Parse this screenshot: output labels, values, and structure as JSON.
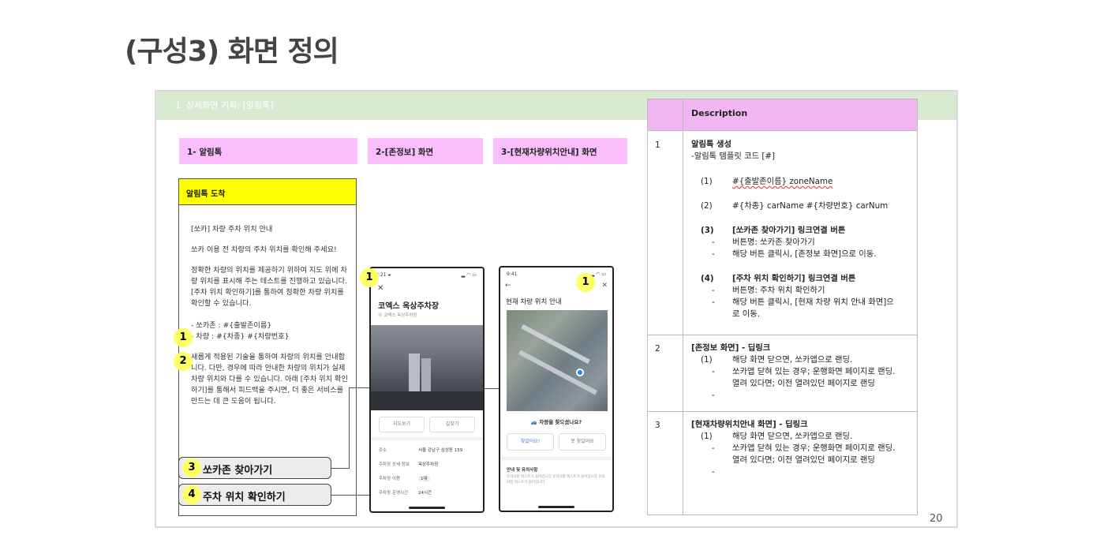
{
  "page_title": "(구성3) 화면 정의",
  "slide_header": "1.      상세화면 기획: [알림톡]",
  "page_number": "20",
  "columns": {
    "col1": "1- 알림톡",
    "col2": "2-[존정보] 화면",
    "col3": "3-[현재차량위치안내] 화면"
  },
  "kakao": {
    "header": "알림톡 도착",
    "p1": "[쏘카] 차량 주차 위치 안내",
    "p2": "쏘카 이용 전 차량의 주차 위치를 확인해 주세요!",
    "p3": "정확한 차량의 위치를 제공하기 위하여 지도 위에 차량 위치를 표시해 주는 테스트를 진행하고 있습니다. [주차 위치 확인하기]를 통하여 정확한 차량 위치를 확인할 수 있습니다.",
    "line_zone": "- 쏘카존 : #{출발존이름}",
    "line_car": "- 차량 : #{차종} #{차량번호}",
    "p4": "새롭게 적용된 기술을 통하여 차량의 위치를 안내합니다. 다만, 경우에 따라 안내한 차량의 위치가 실제 차량 위치와 다를 수 있습니다. 아래 [주차 위치 확인하기]를 통해서 피드백을 주시면, 더 좋은 서비스를 만드는 데 큰 도움이 됩니다.",
    "btn_zone": "쏘카존 찾아가기",
    "btn_parking": "주차 위치 확인하기"
  },
  "badges": {
    "b1": "1",
    "b2": "2",
    "b3": "3",
    "b4": "4",
    "phone1": "1",
    "phone2": "1"
  },
  "phone1": {
    "time": "3:21 ◂",
    "title": "코엑스 옥상주차장",
    "subtitle": "⓪ 코엑스 옥상주차장",
    "tab_left": "지도보기",
    "tab_right": "길찾기",
    "rows": [
      {
        "label": "주소",
        "value": "서울 강남구 삼성동 159"
      },
      {
        "label": "주차장 상세 정보",
        "value": "옥상주차장"
      },
      {
        "label": "주차장 이용",
        "value": "1대"
      },
      {
        "label": "주차장 운영시간",
        "value": "24시간"
      }
    ]
  },
  "phone2": {
    "time": "9:41",
    "title": "현재 차량 위치 안내",
    "question": "🚙 차량을 찾으셨나요?",
    "btn_yes": "찾았어요!",
    "btn_no": "못 찾았어요",
    "note_title": "안내 및 유의사항",
    "note_text": "유의사항 텍스트가 들어갑니다 유의사항 텍스트가 들어갑니다 유의사항 텍스트가 들어갑니다."
  },
  "table": {
    "header": "Description",
    "rows": [
      {
        "num": "1"
      },
      {
        "num": "2"
      },
      {
        "num": "3"
      }
    ],
    "r1": {
      "title": "알림톡 생성",
      "sub": "-알림톡 템플릿 코드 [#]",
      "i1_num": "(1)",
      "i1_text": "#{출발존이름} zoneName",
      "i2_num": "(2)",
      "i2_text": "#{차종} carName  #{차량번호} carNum",
      "i3_num": "(3)",
      "i3_title": "[쏘카존 찾아가기] 링크연결 버튼",
      "i3_a": "버튼명: 쏘카존 찾아가기",
      "i3_b": "해당 버튼 클릭시, [존정보 화면]으로 이동.",
      "i4_num": "(4)",
      "i4_title": "[주차 위치 확인하기] 링크연결 버튼",
      "i4_a": "버튼명: 주차 위치 확인하기",
      "i4_b": "해당 버튼 클릭시, [현재 차량 위치 안내 화면]으로 이동."
    },
    "r2": {
      "title": "[존정보 화면] - 딥링크",
      "n": "(1)",
      "a": "해당 화면 닫으면, 쏘카앱으로 랜딩.",
      "b": "쏘카앱 닫혀 있는 경우; 운행화면 페이지로 랜딩.",
      "c": "열려 있다면; 이전 열려있던 페이지로 랜딩"
    },
    "r3": {
      "title": "[현재차량위치안내 화면] - 딥링크",
      "n": "(1)",
      "a": "해당 화면 닫으면, 쏘카앱으로 랜딩.",
      "b": "쏘카앱 닫혀 있는 경우; 운행화면 페이지로 랜딩.",
      "c": "열려 있다면; 이전 열려있던 페이지로 랜딩"
    },
    "dash": "-"
  }
}
